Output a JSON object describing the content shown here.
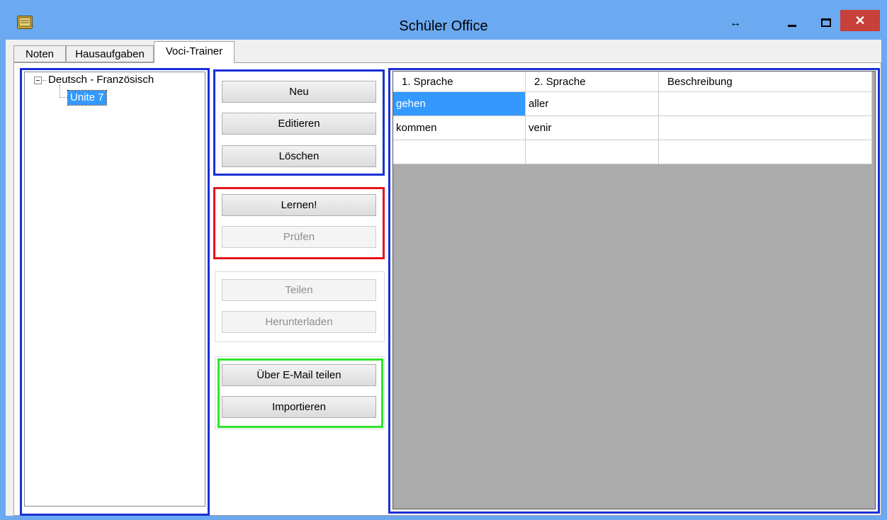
{
  "window": {
    "title": "Schüler Office",
    "resize_glyph": "↔",
    "close_glyph": "✕"
  },
  "tabs": [
    {
      "label": "Noten"
    },
    {
      "label": "Hausaufgaben"
    },
    {
      "label": "Voci-Trainer",
      "selected": true
    }
  ],
  "tree": {
    "root": "Deutsch - Französisch",
    "children": [
      "Unite 7"
    ],
    "selected_child": "Unite 7"
  },
  "buttons": {
    "neu": "Neu",
    "editieren": "Editieren",
    "loeschen": "Löschen",
    "lernen": "Lernen!",
    "pruefen": "Prüfen",
    "teilen": "Teilen",
    "herunterladen": "Herunterladen",
    "mail": "Über E-Mail teilen",
    "importieren": "Importieren"
  },
  "grid": {
    "headers": [
      "1. Sprache",
      "2. Sprache",
      "Beschreibung"
    ],
    "rows": [
      [
        "gehen",
        "aller",
        ""
      ],
      [
        "kommen",
        "venir",
        ""
      ],
      [
        "",
        "",
        ""
      ]
    ],
    "selected_cell": "gehen"
  },
  "colors": {
    "titlebar": "#6ba9f1",
    "close": "#c7403a",
    "outline_blue": "#1a2fd6",
    "outline_red": "#e5131b",
    "outline_green": "#2de62d",
    "selection": "#3399ff",
    "grid_bg": "#ababab"
  },
  "icons": [
    "app-icon",
    "resize-icon",
    "minimize-icon",
    "maximize-icon",
    "close-icon",
    "tree-collapse-icon"
  ]
}
